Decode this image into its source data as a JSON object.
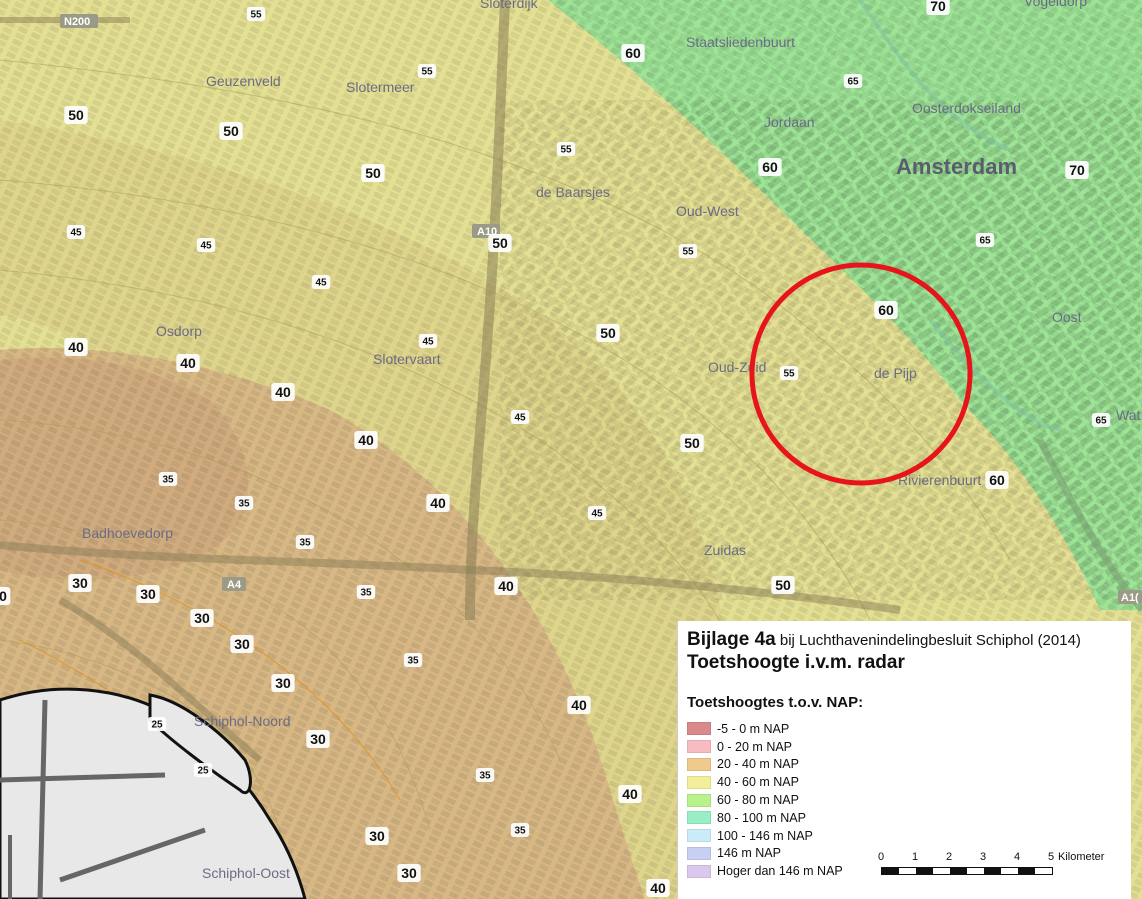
{
  "map": {
    "place_labels": {
      "sloterdijk": "Sloterdijk",
      "staatsliedenbuurt": "Staatsliedenbuurt",
      "vogeldorp": "Vogeldorp",
      "geuzenveld": "Geuzenveld",
      "slotermeer": "Slotermeer",
      "oosterdokseiland": "Oosterdokseiland",
      "jordaan": "Jordaan",
      "amsterdam": "Amsterdam",
      "de_baarsjes": "de Baarsjes",
      "oud_west": "Oud-West",
      "osdorp": "Osdorp",
      "slotervaart": "Slotervaart",
      "oud_zuid": "Oud-Zuid",
      "de_pijp": "de Pijp",
      "oost": "Oost",
      "watergraafsmeer": "Wat",
      "rivierenbuurt": "Rivierenbuurt",
      "badhoevedorp": "Badhoevedorp",
      "zuidas": "Zuidas",
      "schiphol_noord": "Schiphol-Noord",
      "schiphol_oost": "Schiphol-Oost"
    },
    "road_labels": {
      "n200": "N200",
      "a10_west": "A10",
      "a4": "A4",
      "a10_east": "A1("
    },
    "contour_labels": {
      "l55a": "55",
      "l70a": "70",
      "l60a": "60",
      "l55b": "55",
      "l65a": "65",
      "l50a": "50",
      "l50b": "50",
      "l55c": "55",
      "l60b": "60",
      "l50c": "50",
      "l70b": "70",
      "l45a": "45",
      "l45b": "45",
      "l50d": "50",
      "l55d": "55",
      "l65b": "65",
      "l45c": "45",
      "l60c": "60",
      "l50e": "50",
      "l45d": "45",
      "l40a": "40",
      "l40b": "40",
      "l55e": "55",
      "l45e": "45",
      "l65c": "65",
      "l40c": "40",
      "l50f": "50",
      "l40d": "40",
      "l35a": "35",
      "l35b": "35",
      "l40e": "40",
      "l60d": "60",
      "l45f": "45",
      "l35c": "35",
      "l30a": "30",
      "l30b": "30",
      "l0": "0",
      "l40f": "40",
      "l50g": "50",
      "l35d": "35",
      "l30c": "30",
      "l30d": "30",
      "l35e": "35",
      "l30e": "30",
      "l25a": "25",
      "l40g": "40",
      "l30f": "30",
      "l25b": "25",
      "l35f": "35",
      "l40h": "40",
      "l35g": "35",
      "l30g": "30",
      "l30h": "30",
      "l40i": "40"
    },
    "colors": {
      "zone_0_20": "#d9b98a",
      "zone_20_40": "#d8c48c",
      "zone_40_60": "#e3e08e",
      "zone_60_80": "#9fe39a",
      "highlight_circle": "#e8141b"
    }
  },
  "legend": {
    "title_main": "Bijlage 4a",
    "title_sub": " bij Luchthavenindelingbesluit Schiphol (2014)",
    "title_line2": "Toetshoogte i.v.m. radar",
    "heading": "Toetshoogtes t.o.v. NAP:",
    "items": [
      {
        "label": "-5 - 0 m NAP",
        "color": "#d9898c"
      },
      {
        "label": "0 - 20 m NAP",
        "color": "#f7bcc1"
      },
      {
        "label": "20 - 40 m NAP",
        "color": "#f0c98c"
      },
      {
        "label": "40 - 60 m NAP",
        "color": "#f2ee9a"
      },
      {
        "label": "60 - 80 m NAP",
        "color": "#b9f28c"
      },
      {
        "label": "80 - 100 m NAP",
        "color": "#9aeec6"
      },
      {
        "label": "100 - 146 m NAP",
        "color": "#c9ecf8"
      },
      {
        "label": "146 m NAP",
        "color": "#c8cff3"
      },
      {
        "label": "Hoger dan 146 m NAP",
        "color": "#dcc8ee"
      }
    ],
    "scale": {
      "ticks": [
        "0",
        "1",
        "2",
        "3",
        "4",
        "5"
      ],
      "unit": "Kilometer"
    }
  }
}
